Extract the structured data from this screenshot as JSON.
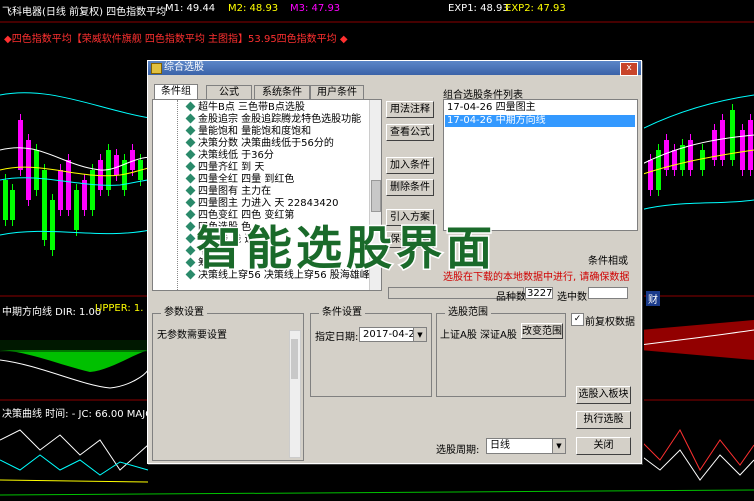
{
  "header": {
    "line1": "飞科电器(日线 前复权) 四色指数平均",
    "m1": "M1: 49.44",
    "m2": "M2: 48.93",
    "m3": "M3: 47.93",
    "exp1": "EXP1: 48.93",
    "exp2": "EXP2: 47.93",
    "line2": "◆四色指数平均【荣威软件旗舰 四色指数平均 主图指】53.95四色指数平均 ◆"
  },
  "panels": {
    "mid_label": "中期方向线 DIR: 1.00",
    "upper": "UPPER: 1.",
    "low_label": "决策曲线 时间: - JC: 66.00 MAJO"
  },
  "dialog": {
    "title": "综合选股",
    "tabs": [
      "条件组",
      "公式",
      "系统条件",
      "用户条件"
    ],
    "tree_items": [
      "超牛B点    三色带B点选股",
      "金股追宗   金股追踪腾龙特色选股功能",
      "量能饱和   量能饱和度饱和",
      "决策分数   决策曲线低于56分的",
      "决策线低   于36分",
      "四量齐红   到    天",
      "四量全红   四量    到红色",
      "四量图有   主力在",
      "四量图主   力进入     天     22843420",
      "四色变红   四色     变红第",
      "四色选股   色",
      "牛熊线     线           选股",
      "中          中",
      "筹          筹",
      "决策线上穿56  决策线上穿56  股海雄峰"
    ],
    "side_buttons": [
      "用法注释",
      "查看公式",
      "加入条件",
      "删除条件",
      "引入方案",
      "保存方案"
    ],
    "cond_list_title": "组合选股条件列表",
    "cond_list": [
      "17-04-26  四量图主",
      "17-04-26  中期方向线"
    ],
    "radio_label": "条件相或",
    "warning": "选股在下载的本地数据中进行, 请确保数据",
    "stock_count_label": "品种数",
    "stock_count_value": "3227",
    "selected_label": "选中数",
    "param_title": "参数设置",
    "param_text": "无参数需要设置",
    "cond_set_title": "条件设置",
    "date_label": "指定日期:",
    "date_value": "2017-04-26",
    "range_title": "选股范围",
    "range_text": "上证A股 深证A股",
    "change_range": "改变范围",
    "period_label": "选股周期:",
    "period_value": "日线",
    "checkbox_label": "前复权数据",
    "checkbox_mark": "✓",
    "btn_add_block": "选股入板块",
    "btn_execute": "执行选股",
    "btn_close": "关闭",
    "close_x": "x"
  },
  "overlay_text": "智能选股界面",
  "right_tag": "财"
}
